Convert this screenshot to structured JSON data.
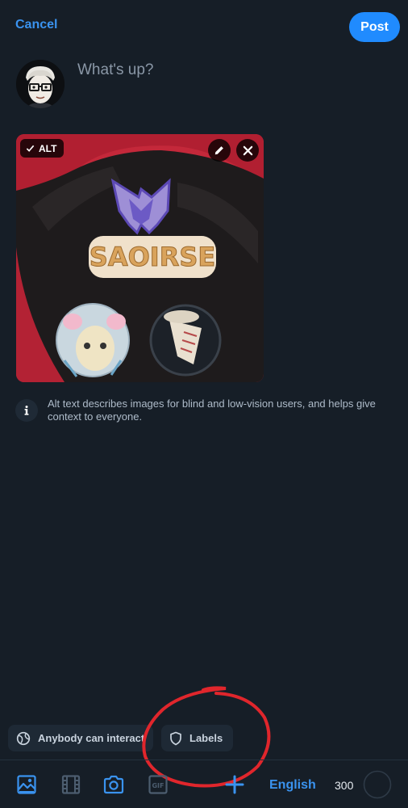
{
  "header": {
    "cancel_label": "Cancel",
    "post_label": "Post"
  },
  "composer": {
    "placeholder": "What's up?",
    "avatar_icon": "avatar-illustration"
  },
  "image": {
    "alt_badge_label": "ALT",
    "alt_check_icon": "check-icon",
    "edit_icon": "pencil-icon",
    "remove_icon": "close-icon",
    "content_icon": "photo-of-pins-on-bag",
    "pin_text": "SAOIRSE"
  },
  "info": {
    "icon": "info-icon",
    "text": "Alt text describes images for blind and low-vision users, and helps give context to everyone."
  },
  "chips": {
    "interaction_label": "Anybody can interact",
    "interaction_icon": "globe-icon",
    "labels_label": "Labels",
    "labels_icon": "shield-icon"
  },
  "toolbar": {
    "gallery_icon": "image-icon",
    "video_icon": "film-icon",
    "camera_icon": "camera-icon",
    "gif_icon": "gif-icon",
    "gif_text": "GIF",
    "add_icon": "plus-icon",
    "language_label": "English",
    "char_count": "300",
    "char_progress": 0
  },
  "colors": {
    "background": "#161e27",
    "accent": "#208bfe",
    "link": "#3a93ef",
    "annotation": "#e0262c"
  }
}
